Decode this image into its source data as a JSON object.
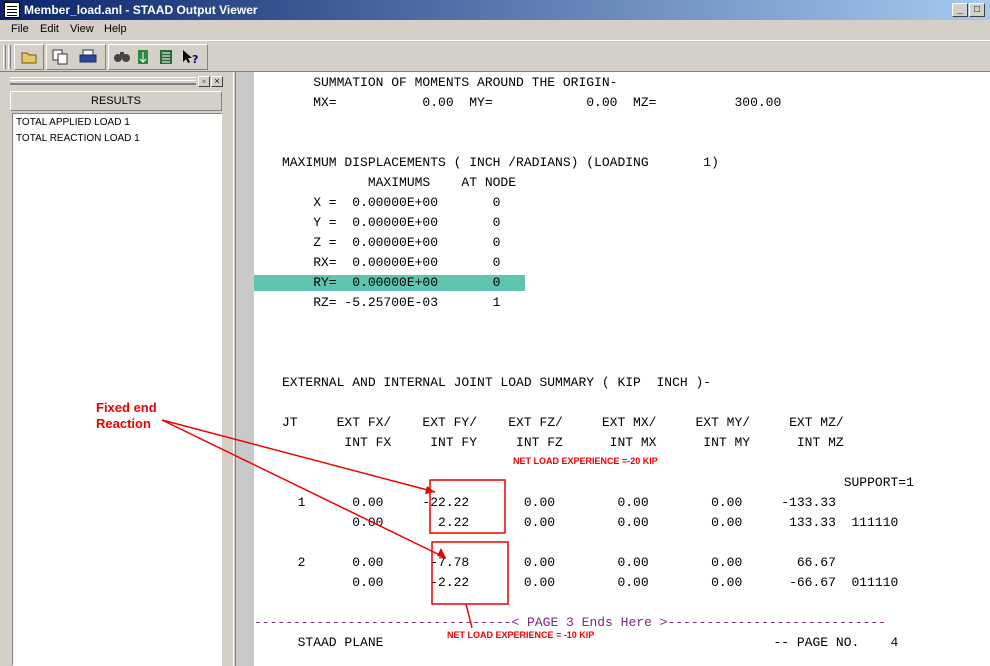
{
  "window": {
    "title": "Member_load.anl - STAAD Output Viewer",
    "min_label": "_",
    "max_label": "□"
  },
  "menu": [
    "File",
    "Edit",
    "View",
    "Help"
  ],
  "toolbar": {
    "icons": [
      "open-folder-icon",
      "copy-icon",
      "print-icon",
      "find-icon",
      "goto-icon",
      "list-icon",
      "context-help-icon"
    ]
  },
  "sidebar": {
    "header": "RESULTS",
    "items": [
      {
        "label": "TOTAL APPLIED LOAD   1"
      },
      {
        "label": "TOTAL REACTION LOAD   1"
      }
    ]
  },
  "report": {
    "lines": [
      "    SUMMATION OF MOMENTS AROUND THE ORIGIN-",
      "    MX=           0.00  MY=            0.00  MZ=          300.00",
      "MAXIMUM DISPLACEMENTS ( INCH /RADIANS) (LOADING       1)",
      "           MAXIMUMS    AT NODE",
      "    X =  0.00000E+00       0",
      "    Y =  0.00000E+00       0",
      "    Z =  0.00000E+00       0",
      "    RX=  0.00000E+00       0",
      "    RY=  0.00000E+00       0",
      "    RZ= -5.25700E-03       1",
      "EXTERNAL AND INTERNAL JOINT LOAD SUMMARY ( KIP  INCH )-",
      "JT     EXT FX/    EXT FY/    EXT FZ/     EXT MX/     EXT MY/     EXT MZ/",
      "        INT FX     INT FY     INT FZ      INT MX      INT MY      INT MZ",
      "                                                                        SUPPORT=1",
      "  1      0.00     -22.22       0.00        0.00        0.00     -133.33",
      "         0.00       2.22       0.00        0.00        0.00      133.33  111110",
      "  2      0.00      -7.78       0.00        0.00        0.00       66.67",
      "         0.00      -2.22       0.00        0.00        0.00      -66.67  011110",
      "---------------------------------< PAGE 3 Ends Here >----------------------------",
      "  STAAD PLANE                                                  -- PAGE NO.    4"
    ]
  },
  "annotations": {
    "fixed_end": "Fixed end\nReaction",
    "net_load_1": "NET LOAD EXPERIENCE =-20 KIP",
    "net_load_2": "NET LOAD EXPERIENCE = -10 KIP",
    "color": "#e00000"
  },
  "colors": {
    "title_start": "#0a246a",
    "title_end": "#a6caf0",
    "highlight": "#5fc4b0",
    "page_break": "#7a2a7a"
  }
}
